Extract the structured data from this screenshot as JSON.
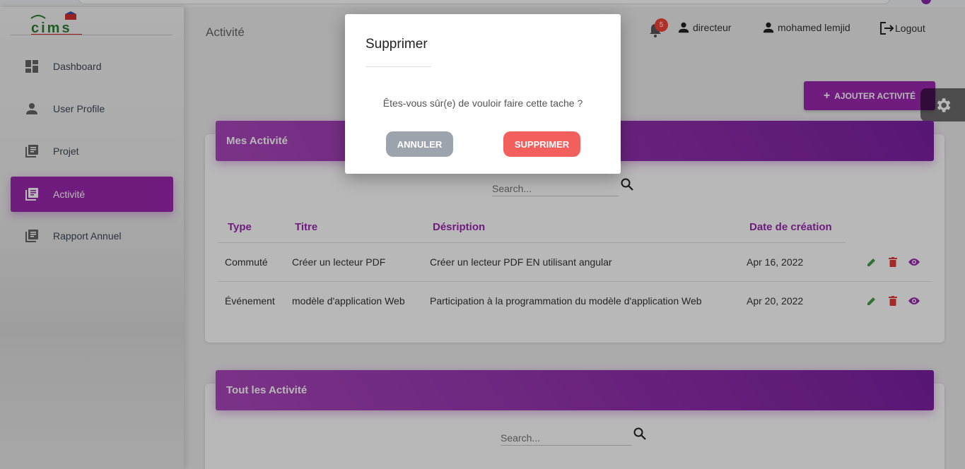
{
  "sidebar": {
    "logo_text": "cims",
    "items": [
      {
        "label": "Dashboard",
        "icon": "dashboard-icon"
      },
      {
        "label": "User Profile",
        "icon": "person-icon"
      },
      {
        "label": "Projet",
        "icon": "library-books-icon"
      },
      {
        "label": "Activité",
        "icon": "library-books-icon"
      },
      {
        "label": "Rapport Annuel",
        "icon": "library-books-icon"
      }
    ],
    "active_index": 3
  },
  "header": {
    "page_title": "Activité",
    "notification_count": "5",
    "role_label": "directeur",
    "user_name": "mohamed lemjid",
    "logout_label": "Logout"
  },
  "toolbar": {
    "add_label": "AJOUTER ACTIVITÉ"
  },
  "mes_activite": {
    "title": "Mes Activité",
    "search_placeholder": "Search...",
    "columns": [
      "Type",
      "Titre",
      "Désription",
      "Date de création"
    ],
    "rows": [
      {
        "type": "Commuté",
        "titre": "Créer un lecteur PDF",
        "description": "Créer un lecteur PDF EN utilisant angular",
        "date": "Apr 16, 2022"
      },
      {
        "type": "Événement",
        "titre": "modèle d'application Web",
        "description": "Participation à la programmation du modèle d'application Web",
        "date": "Apr 20, 2022"
      }
    ]
  },
  "tout_activite": {
    "title": "Tout les Activité",
    "search_placeholder": "Search..."
  },
  "modal": {
    "title": "Supprimer",
    "message": "Êtes-vous sûr(e) de vouloir faire cette tache ?",
    "cancel_label": "ANNULER",
    "confirm_label": "SUPPRIMER"
  },
  "colors": {
    "accent": "#9c27b0",
    "edit": "#43a047",
    "delete": "#e53935",
    "view": "#9c27b0",
    "danger_button": "#f25f5c",
    "cancel_button": "#9ea4ae"
  }
}
